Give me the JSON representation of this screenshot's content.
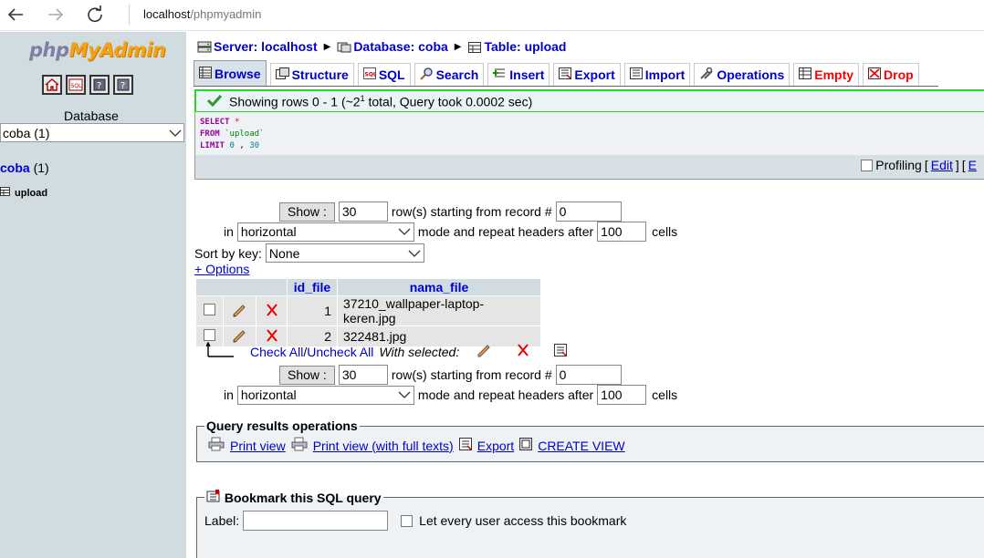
{
  "browser": {
    "host": "localhost",
    "path": "/phpmyadmin"
  },
  "left": {
    "logo_part1": "php",
    "logo_part2": "MyAdmin",
    "db_label": "Database",
    "db_selected": "coba (1)",
    "db_link": "coba",
    "db_count": " (1)",
    "table_link": "upload"
  },
  "breadcrumb": {
    "server": "Server: localhost",
    "database": "Database: coba",
    "table": "Table: upload"
  },
  "tabs": [
    {
      "label": "Browse",
      "icon": "browse-icon"
    },
    {
      "label": "Structure",
      "icon": "structure-icon"
    },
    {
      "label": "SQL",
      "icon": "sql-icon"
    },
    {
      "label": "Search",
      "icon": "search-icon"
    },
    {
      "label": "Insert",
      "icon": "insert-icon"
    },
    {
      "label": "Export",
      "icon": "export-icon"
    },
    {
      "label": "Import",
      "icon": "import-icon"
    },
    {
      "label": "Operations",
      "icon": "operations-icon"
    },
    {
      "label": "Empty",
      "icon": "empty-icon"
    },
    {
      "label": "Drop",
      "icon": "drop-icon"
    }
  ],
  "notice": {
    "pre": "Showing rows 0 - 1 (~2",
    "sup": "1",
    "post": " total, Query took 0.0002 sec)"
  },
  "sql": {
    "select": "SELECT",
    "star": "*",
    "from": "FROM",
    "table": "`upload`",
    "limit": "LIMIT",
    "lim_a": "0",
    "lim_sep": ",",
    "lim_b": "30"
  },
  "profiling": {
    "label": "Profiling",
    "open": "[",
    "edit": "Edit",
    "close": "]",
    "open2": "[",
    "explain": "E"
  },
  "nav": {
    "show_label": "Show :",
    "rows_value": "30",
    "rows_text": "row(s) starting from record #",
    "start_value": "0",
    "in_text": "in",
    "mode_value": "horizontal",
    "mode_text": "mode and repeat headers after",
    "repeat_value": "100",
    "cells_text": "cells"
  },
  "sort": {
    "label": "Sort by key:",
    "value": "None"
  },
  "options_link": "+ Options",
  "table": {
    "columns": [
      "id_file",
      "nama_file"
    ],
    "rows": [
      {
        "id": "1",
        "name": "37210_wallpaper-laptop-keren.jpg"
      },
      {
        "id": "2",
        "name": "322481.jpg"
      }
    ]
  },
  "with_selected": {
    "check_all": "Check All",
    "slash": " / ",
    "uncheck_all": "Uncheck All",
    "label": "With selected:"
  },
  "query_ops": {
    "legend": "Query results operations",
    "print_view": "Print view",
    "print_full": "Print view (with full texts)",
    "export": "Export",
    "create_view": "CREATE VIEW"
  },
  "bookmark": {
    "legend": "Bookmark this SQL query",
    "label": "Label:",
    "label_value": "",
    "every_user": "Let every user access this bookmark"
  },
  "colors": {
    "link": "#0000cc",
    "left_bg": "#d0dce0",
    "notice_border": "#2ad82a",
    "danger": "#ff0000"
  }
}
